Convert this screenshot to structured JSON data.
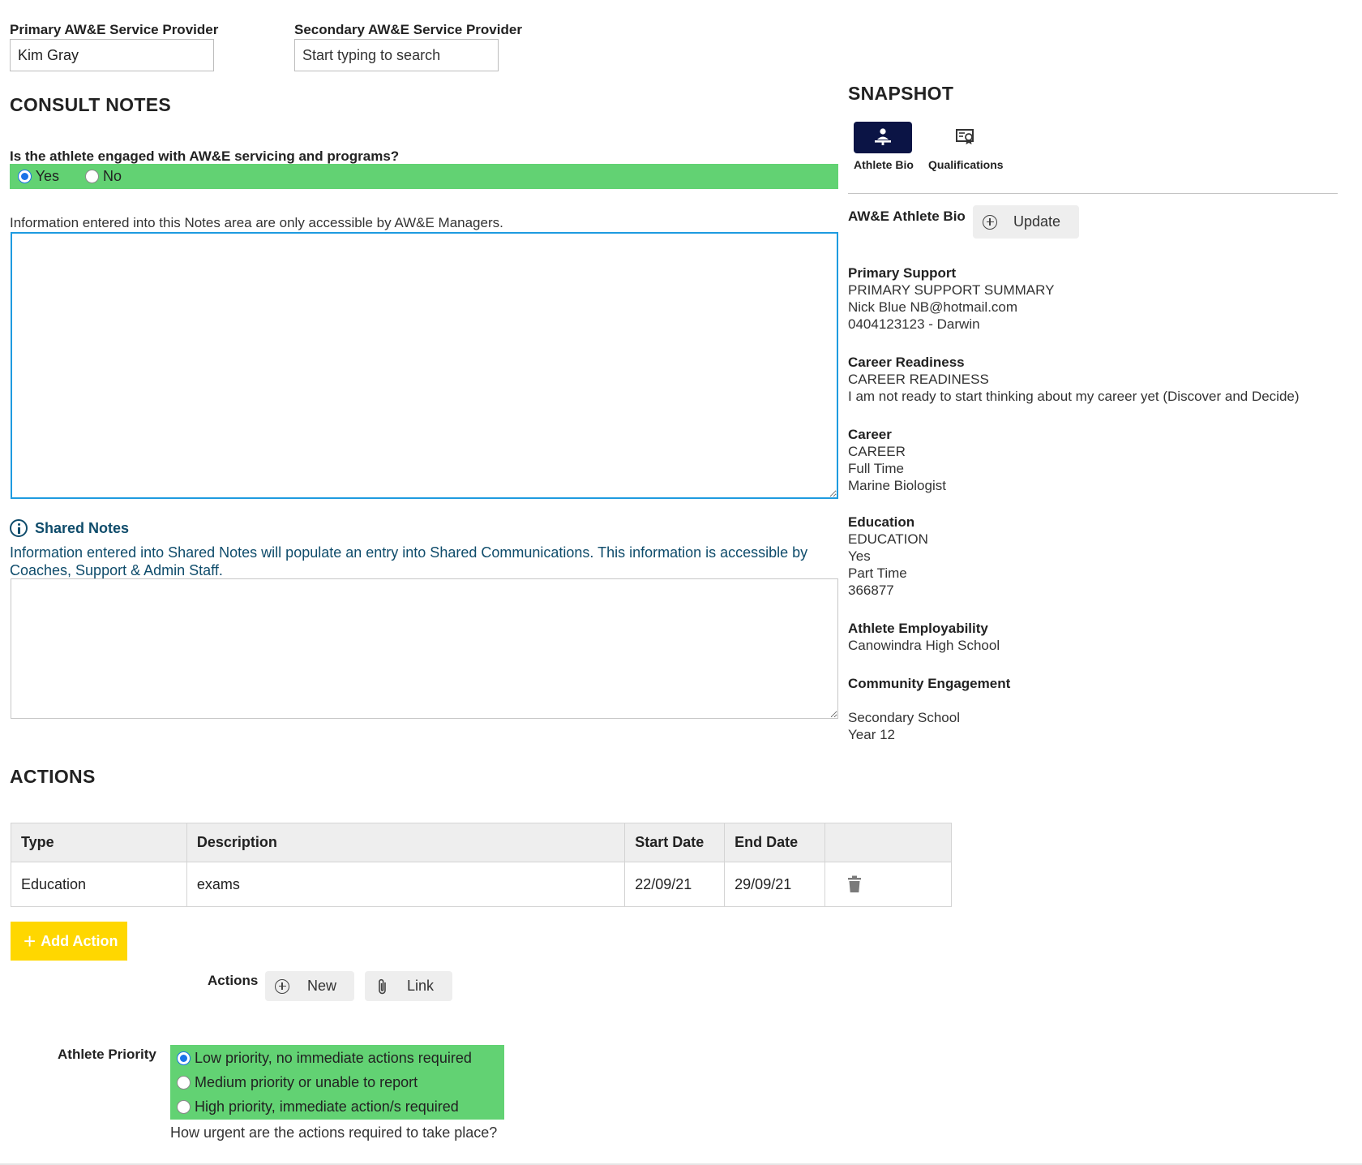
{
  "providers": {
    "primary_label": "Primary AW&E Service Provider",
    "primary_value": "Kim Gray",
    "secondary_label": "Secondary AW&E Service Provider",
    "secondary_placeholder": "Start typing to search"
  },
  "consult": {
    "title": "CONSULT NOTES",
    "engaged_question": "Is the athlete engaged with AW&E servicing and programs?",
    "engaged_yes": "Yes",
    "engaged_no": "No",
    "engaged_selected": "Yes",
    "notes_info": "Information entered into this Notes area are only accessible by AW&E Managers.",
    "shared_title": "Shared Notes",
    "shared_info": "Information entered into Shared Notes will populate an entry into Shared Communications. This information is accessible by Coaches, Support & Admin Staff."
  },
  "snapshot": {
    "title": "SNAPSHOT",
    "tabs": [
      {
        "label": "Athlete Bio",
        "icon": "person-at-desk-icon",
        "active": true
      },
      {
        "label": "Qualifications",
        "icon": "certificate-icon",
        "active": false
      }
    ],
    "bio_label": "AW&E Athlete Bio",
    "update_label": "Update",
    "sections": [
      {
        "heading": "Primary Support",
        "lines": [
          "PRIMARY SUPPORT SUMMARY",
          "Nick Blue NB@hotmail.com",
          "0404123123 - Darwin"
        ]
      },
      {
        "heading": "Career Readiness",
        "lines": [
          "CAREER READINESS",
          "I am not ready to start thinking about my career yet (Discover and Decide)"
        ]
      },
      {
        "heading": "Career",
        "lines": [
          "CAREER",
          "Full Time",
          "Marine Biologist"
        ]
      },
      {
        "heading": "Education",
        "lines": [
          "EDUCATION",
          "Yes",
          "Part Time",
          "366877"
        ]
      },
      {
        "heading": "Athlete Employability",
        "lines": [
          "Canowindra High School"
        ]
      },
      {
        "heading": "Community Engagement",
        "lines": [
          "Secondary School",
          "Year 12"
        ]
      }
    ]
  },
  "actions": {
    "title": "ACTIONS",
    "columns": [
      "Type",
      "Description",
      "Start Date",
      "End Date",
      ""
    ],
    "rows": [
      {
        "type": "Education",
        "description": "exams",
        "start": "22/09/21",
        "end": "29/09/21"
      }
    ],
    "add_label": "Add Action",
    "actions_label": "Actions",
    "new_label": "New",
    "link_label": "Link"
  },
  "priority": {
    "label": "Athlete Priority",
    "options": [
      "Low priority, no immediate actions required",
      "Medium priority or unable to report",
      "High priority, immediate action/s required"
    ],
    "selected_index": 0,
    "hint": "How urgent are the actions required to take place?"
  },
  "colors": {
    "green": "#62d273",
    "navy": "#0b1445",
    "yellow": "#ffd700",
    "teal_text": "#0f4c6b",
    "focus_blue": "#1e9be0"
  }
}
